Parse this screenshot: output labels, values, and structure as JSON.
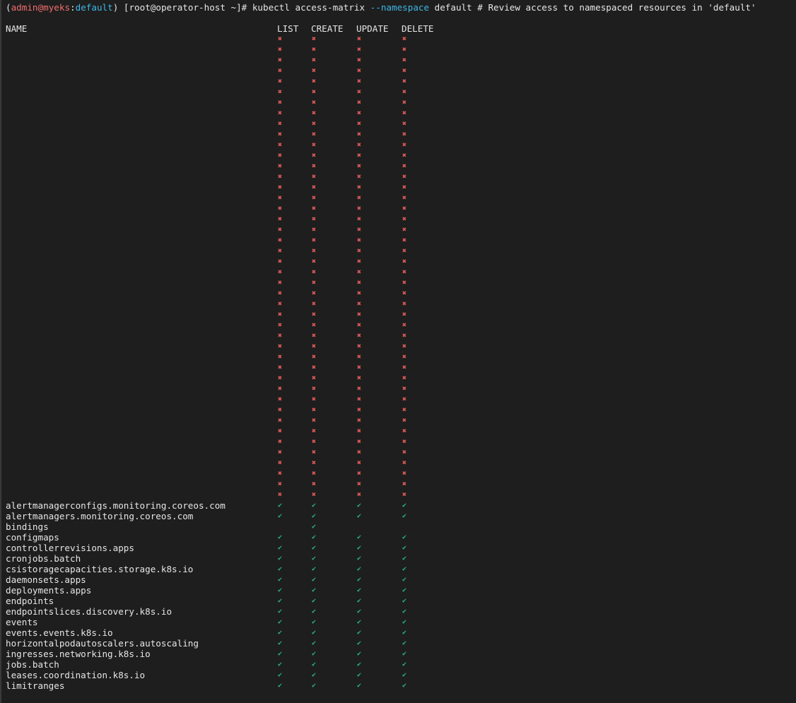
{
  "prompt": {
    "open_paren": "(",
    "user": "admin",
    "at": "@",
    "cluster": "myeks",
    "colon": ":",
    "namespace": "default",
    "close_paren": ")",
    "shell_prefix": " [root@operator-host ~]# kubectl access-matrix ",
    "flag": "--namespace",
    "rest": " default # Review access to namespaced resources in 'default'"
  },
  "colors": {
    "background": "#1e1e1e",
    "prompt_red": "#f26d6d",
    "prompt_cyan": "#3fb6e6",
    "allow_green": "#26b37a",
    "deny_red": "#e05a5a"
  },
  "icons": {
    "allow": "check-icon",
    "deny": "cross-icon"
  },
  "table": {
    "headers": [
      "NAME",
      "LIST",
      "CREATE",
      "UPDATE",
      "DELETE"
    ],
    "rows": [
      {
        "name": "",
        "perms": [
          "deny",
          "deny",
          "deny",
          "deny"
        ]
      },
      {
        "name": "",
        "perms": [
          "deny",
          "deny",
          "deny",
          "deny"
        ]
      },
      {
        "name": "",
        "perms": [
          "deny",
          "deny",
          "deny",
          "deny"
        ]
      },
      {
        "name": "",
        "perms": [
          "deny",
          "deny",
          "deny",
          "deny"
        ]
      },
      {
        "name": "",
        "perms": [
          "deny",
          "deny",
          "deny",
          "deny"
        ]
      },
      {
        "name": "",
        "perms": [
          "deny",
          "deny",
          "deny",
          "deny"
        ]
      },
      {
        "name": "",
        "perms": [
          "deny",
          "deny",
          "deny",
          "deny"
        ]
      },
      {
        "name": "",
        "perms": [
          "deny",
          "deny",
          "deny",
          "deny"
        ]
      },
      {
        "name": "",
        "perms": [
          "deny",
          "deny",
          "deny",
          "deny"
        ]
      },
      {
        "name": "",
        "perms": [
          "deny",
          "deny",
          "deny",
          "deny"
        ]
      },
      {
        "name": "",
        "perms": [
          "deny",
          "deny",
          "deny",
          "deny"
        ]
      },
      {
        "name": "",
        "perms": [
          "deny",
          "deny",
          "deny",
          "deny"
        ]
      },
      {
        "name": "",
        "perms": [
          "deny",
          "deny",
          "deny",
          "deny"
        ]
      },
      {
        "name": "",
        "perms": [
          "deny",
          "deny",
          "deny",
          "deny"
        ]
      },
      {
        "name": "",
        "perms": [
          "deny",
          "deny",
          "deny",
          "deny"
        ]
      },
      {
        "name": "",
        "perms": [
          "deny",
          "deny",
          "deny",
          "deny"
        ]
      },
      {
        "name": "",
        "perms": [
          "deny",
          "deny",
          "deny",
          "deny"
        ]
      },
      {
        "name": "",
        "perms": [
          "deny",
          "deny",
          "deny",
          "deny"
        ]
      },
      {
        "name": "",
        "perms": [
          "deny",
          "deny",
          "deny",
          "deny"
        ]
      },
      {
        "name": "",
        "perms": [
          "deny",
          "deny",
          "deny",
          "deny"
        ]
      },
      {
        "name": "",
        "perms": [
          "deny",
          "deny",
          "deny",
          "deny"
        ]
      },
      {
        "name": "",
        "perms": [
          "deny",
          "deny",
          "deny",
          "deny"
        ]
      },
      {
        "name": "",
        "perms": [
          "deny",
          "deny",
          "deny",
          "deny"
        ]
      },
      {
        "name": "",
        "perms": [
          "deny",
          "deny",
          "deny",
          "deny"
        ]
      },
      {
        "name": "",
        "perms": [
          "deny",
          "deny",
          "deny",
          "deny"
        ]
      },
      {
        "name": "",
        "perms": [
          "deny",
          "deny",
          "deny",
          "deny"
        ]
      },
      {
        "name": "",
        "perms": [
          "deny",
          "deny",
          "deny",
          "deny"
        ]
      },
      {
        "name": "",
        "perms": [
          "deny",
          "deny",
          "deny",
          "deny"
        ]
      },
      {
        "name": "",
        "perms": [
          "deny",
          "deny",
          "deny",
          "deny"
        ]
      },
      {
        "name": "",
        "perms": [
          "deny",
          "deny",
          "deny",
          "deny"
        ]
      },
      {
        "name": "",
        "perms": [
          "deny",
          "deny",
          "deny",
          "deny"
        ]
      },
      {
        "name": "",
        "perms": [
          "deny",
          "deny",
          "deny",
          "deny"
        ]
      },
      {
        "name": "",
        "perms": [
          "deny",
          "deny",
          "deny",
          "deny"
        ]
      },
      {
        "name": "",
        "perms": [
          "deny",
          "deny",
          "deny",
          "deny"
        ]
      },
      {
        "name": "",
        "perms": [
          "deny",
          "deny",
          "deny",
          "deny"
        ]
      },
      {
        "name": "",
        "perms": [
          "deny",
          "deny",
          "deny",
          "deny"
        ]
      },
      {
        "name": "",
        "perms": [
          "deny",
          "deny",
          "deny",
          "deny"
        ]
      },
      {
        "name": "",
        "perms": [
          "deny",
          "deny",
          "deny",
          "deny"
        ]
      },
      {
        "name": "",
        "perms": [
          "deny",
          "deny",
          "deny",
          "deny"
        ]
      },
      {
        "name": "",
        "perms": [
          "deny",
          "deny",
          "deny",
          "deny"
        ]
      },
      {
        "name": "",
        "perms": [
          "deny",
          "deny",
          "deny",
          "deny"
        ]
      },
      {
        "name": "",
        "perms": [
          "deny",
          "deny",
          "deny",
          "deny"
        ]
      },
      {
        "name": "",
        "perms": [
          "deny",
          "deny",
          "deny",
          "deny"
        ]
      },
      {
        "name": "",
        "perms": [
          "deny",
          "deny",
          "deny",
          "deny"
        ]
      },
      {
        "name": "alertmanagerconfigs.monitoring.coreos.com",
        "perms": [
          "allow",
          "allow",
          "allow",
          "allow"
        ]
      },
      {
        "name": "alertmanagers.monitoring.coreos.com",
        "perms": [
          "allow",
          "allow",
          "allow",
          "allow"
        ]
      },
      {
        "name": "bindings",
        "perms": [
          "",
          "allow",
          "",
          ""
        ]
      },
      {
        "name": "configmaps",
        "perms": [
          "allow",
          "allow",
          "allow",
          "allow"
        ]
      },
      {
        "name": "controllerrevisions.apps",
        "perms": [
          "allow",
          "allow",
          "allow",
          "allow"
        ]
      },
      {
        "name": "cronjobs.batch",
        "perms": [
          "allow",
          "allow",
          "allow",
          "allow"
        ]
      },
      {
        "name": "csistoragecapacities.storage.k8s.io",
        "perms": [
          "allow",
          "allow",
          "allow",
          "allow"
        ]
      },
      {
        "name": "daemonsets.apps",
        "perms": [
          "allow",
          "allow",
          "allow",
          "allow"
        ]
      },
      {
        "name": "deployments.apps",
        "perms": [
          "allow",
          "allow",
          "allow",
          "allow"
        ]
      },
      {
        "name": "endpoints",
        "perms": [
          "allow",
          "allow",
          "allow",
          "allow"
        ]
      },
      {
        "name": "endpointslices.discovery.k8s.io",
        "perms": [
          "allow",
          "allow",
          "allow",
          "allow"
        ]
      },
      {
        "name": "events",
        "perms": [
          "allow",
          "allow",
          "allow",
          "allow"
        ]
      },
      {
        "name": "events.events.k8s.io",
        "perms": [
          "allow",
          "allow",
          "allow",
          "allow"
        ]
      },
      {
        "name": "horizontalpodautoscalers.autoscaling",
        "perms": [
          "allow",
          "allow",
          "allow",
          "allow"
        ]
      },
      {
        "name": "ingresses.networking.k8s.io",
        "perms": [
          "allow",
          "allow",
          "allow",
          "allow"
        ]
      },
      {
        "name": "jobs.batch",
        "perms": [
          "allow",
          "allow",
          "allow",
          "allow"
        ]
      },
      {
        "name": "leases.coordination.k8s.io",
        "perms": [
          "allow",
          "allow",
          "allow",
          "allow"
        ]
      },
      {
        "name": "limitranges",
        "perms": [
          "allow",
          "allow",
          "allow",
          "allow"
        ]
      }
    ]
  }
}
